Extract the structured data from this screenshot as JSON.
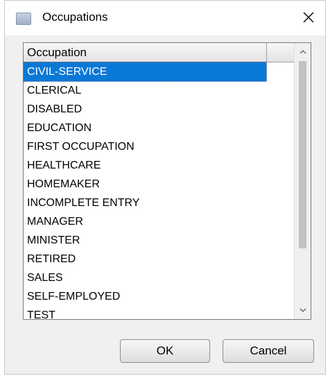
{
  "window": {
    "title": "Occupations",
    "app_icon": "window-icon",
    "close_icon": "close-icon"
  },
  "list": {
    "column_header": "Occupation",
    "selected_index": 0,
    "items": [
      "CIVIL-SERVICE",
      "CLERICAL",
      "DISABLED",
      "EDUCATION",
      "FIRST OCCUPATION",
      "HEALTHCARE",
      "HOMEMAKER",
      "INCOMPLETE ENTRY",
      "MANAGER",
      "MINISTER",
      "RETIRED",
      "SALES",
      "SELF-EMPLOYED",
      "TEST"
    ],
    "scroll_up_icon": "chevron-up-icon",
    "scroll_down_icon": "chevron-down-icon"
  },
  "buttons": {
    "ok_label": "OK",
    "cancel_label": "Cancel"
  },
  "colors": {
    "selection": "#0a78d7",
    "dialog_background": "#f0f0f0"
  }
}
